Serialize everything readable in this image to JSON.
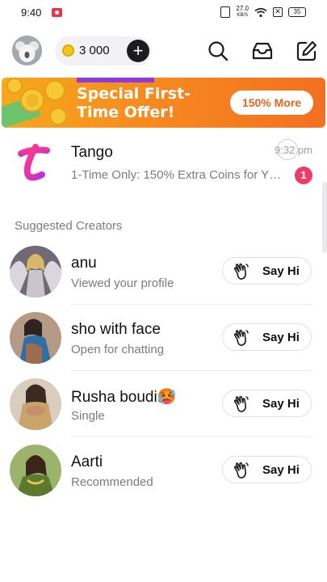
{
  "status_bar": {
    "time": "9:40",
    "net_speed": "27.0",
    "net_unit": "KB/S",
    "battery": "35"
  },
  "header": {
    "coins": "3 000",
    "plus_label": "+"
  },
  "banner": {
    "title": "Special First-Time Offer!",
    "button_label": "150% More"
  },
  "conversation": {
    "name": "Tango",
    "preview": "1-Time Only: 150% Extra Coins for Y…",
    "time": "9:32 pm",
    "unread": "1"
  },
  "section_title": "Suggested Creators",
  "creators": [
    {
      "name": "anu",
      "subtitle": "Viewed your profile",
      "button": "Say Hi"
    },
    {
      "name": "sho with face",
      "subtitle": "Open for chatting",
      "button": "Say Hi"
    },
    {
      "name": "Rusha boudi🥵",
      "subtitle": "Single",
      "button": "Say Hi"
    },
    {
      "name": "Aarti",
      "subtitle": "Recommended",
      "button": "Say Hi"
    }
  ],
  "colors": {
    "accent_pink": "#ee3b67",
    "banner_orange": "#f68a1f",
    "banner_purple": "#8b3bd8",
    "coin_gold": "#f5c518"
  },
  "icons": [
    "record-icon",
    "vibrate-icon",
    "wifi-icon",
    "sim-off-icon",
    "battery-icon",
    "coin-icon",
    "plus-icon",
    "search-icon",
    "inbox-icon",
    "compose-icon",
    "tango-logo-icon",
    "wave-hand-icon"
  ]
}
